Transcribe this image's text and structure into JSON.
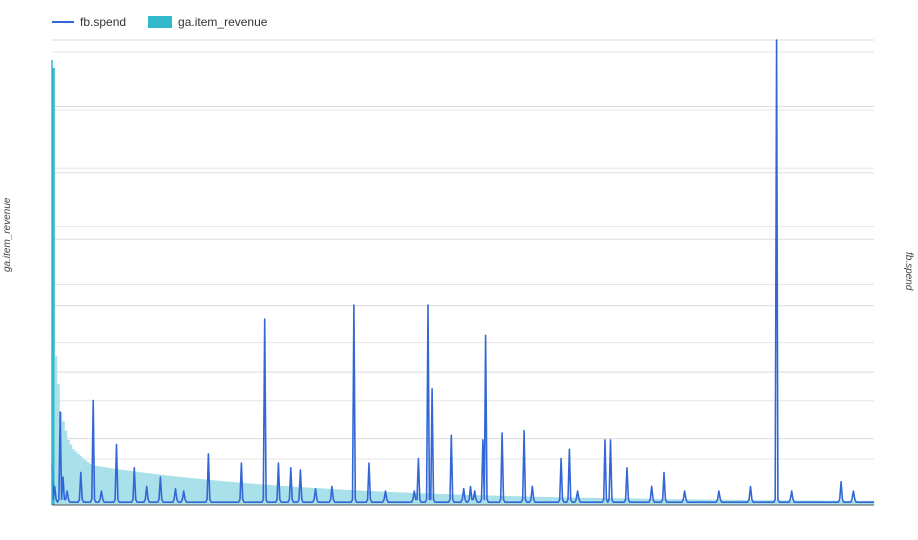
{
  "legend": {
    "line_label": "fb.spend",
    "bar_label": "ga.item_revenue"
  },
  "chart_data": {
    "type": "bar",
    "title": "",
    "ylabel_left": "ga.item_revenue",
    "ylabel_right": "fb.spend",
    "grid": true,
    "legend_position": "top-left",
    "colors": {
      "line": "#3367d6",
      "bar": "#33b8cd",
      "bar_fill": "#a9e0ea"
    },
    "ylim_left": [
      0,
      1.0
    ],
    "ylim_right": [
      0,
      1.0
    ],
    "bars_sorted_descending": true,
    "bar_head": [
      0.94,
      0.32,
      0.26,
      0.2,
      0.18,
      0.16,
      0.14,
      0.13,
      0.12,
      0.115,
      0.11,
      0.105,
      0.1,
      0.096,
      0.092,
      0.088
    ],
    "bar_tail_decay": {
      "start": 0.085,
      "end": 0.006
    },
    "bar_count": 330,
    "line_baseline": 0.006,
    "line_peaks": [
      {
        "pos": 0.0,
        "value": 0.09
      },
      {
        "pos": 0.004,
        "value": 0.04
      },
      {
        "pos": 0.01,
        "value": 0.2
      },
      {
        "pos": 0.013,
        "value": 0.06
      },
      {
        "pos": 0.018,
        "value": 0.03
      },
      {
        "pos": 0.035,
        "value": 0.07
      },
      {
        "pos": 0.05,
        "value": 0.225
      },
      {
        "pos": 0.06,
        "value": 0.03
      },
      {
        "pos": 0.078,
        "value": 0.13
      },
      {
        "pos": 0.1,
        "value": 0.08
      },
      {
        "pos": 0.115,
        "value": 0.04
      },
      {
        "pos": 0.132,
        "value": 0.06
      },
      {
        "pos": 0.15,
        "value": 0.035
      },
      {
        "pos": 0.16,
        "value": 0.03
      },
      {
        "pos": 0.19,
        "value": 0.11
      },
      {
        "pos": 0.23,
        "value": 0.09
      },
      {
        "pos": 0.258,
        "value": 0.4
      },
      {
        "pos": 0.275,
        "value": 0.09
      },
      {
        "pos": 0.29,
        "value": 0.08
      },
      {
        "pos": 0.302,
        "value": 0.075
      },
      {
        "pos": 0.32,
        "value": 0.035
      },
      {
        "pos": 0.34,
        "value": 0.04
      },
      {
        "pos": 0.368,
        "value": 0.43
      },
      {
        "pos": 0.385,
        "value": 0.09
      },
      {
        "pos": 0.405,
        "value": 0.03
      },
      {
        "pos": 0.44,
        "value": 0.03
      },
      {
        "pos": 0.445,
        "value": 0.1
      },
      {
        "pos": 0.457,
        "value": 0.43
      },
      {
        "pos": 0.462,
        "value": 0.25
      },
      {
        "pos": 0.485,
        "value": 0.15
      },
      {
        "pos": 0.5,
        "value": 0.035
      },
      {
        "pos": 0.51,
        "value": 0.04
      },
      {
        "pos": 0.515,
        "value": 0.03
      },
      {
        "pos": 0.525,
        "value": 0.14
      },
      {
        "pos": 0.528,
        "value": 0.365
      },
      {
        "pos": 0.548,
        "value": 0.155
      },
      {
        "pos": 0.575,
        "value": 0.16
      },
      {
        "pos": 0.585,
        "value": 0.04
      },
      {
        "pos": 0.62,
        "value": 0.1
      },
      {
        "pos": 0.63,
        "value": 0.12
      },
      {
        "pos": 0.64,
        "value": 0.03
      },
      {
        "pos": 0.672,
        "value": 0.14
      },
      {
        "pos": 0.68,
        "value": 0.14
      },
      {
        "pos": 0.7,
        "value": 0.08
      },
      {
        "pos": 0.73,
        "value": 0.04
      },
      {
        "pos": 0.745,
        "value": 0.07
      },
      {
        "pos": 0.77,
        "value": 0.03
      },
      {
        "pos": 0.812,
        "value": 0.03
      },
      {
        "pos": 0.85,
        "value": 0.04
      },
      {
        "pos": 0.882,
        "value": 1.0
      },
      {
        "pos": 0.9,
        "value": 0.03
      },
      {
        "pos": 0.96,
        "value": 0.05
      },
      {
        "pos": 0.975,
        "value": 0.03
      }
    ]
  }
}
